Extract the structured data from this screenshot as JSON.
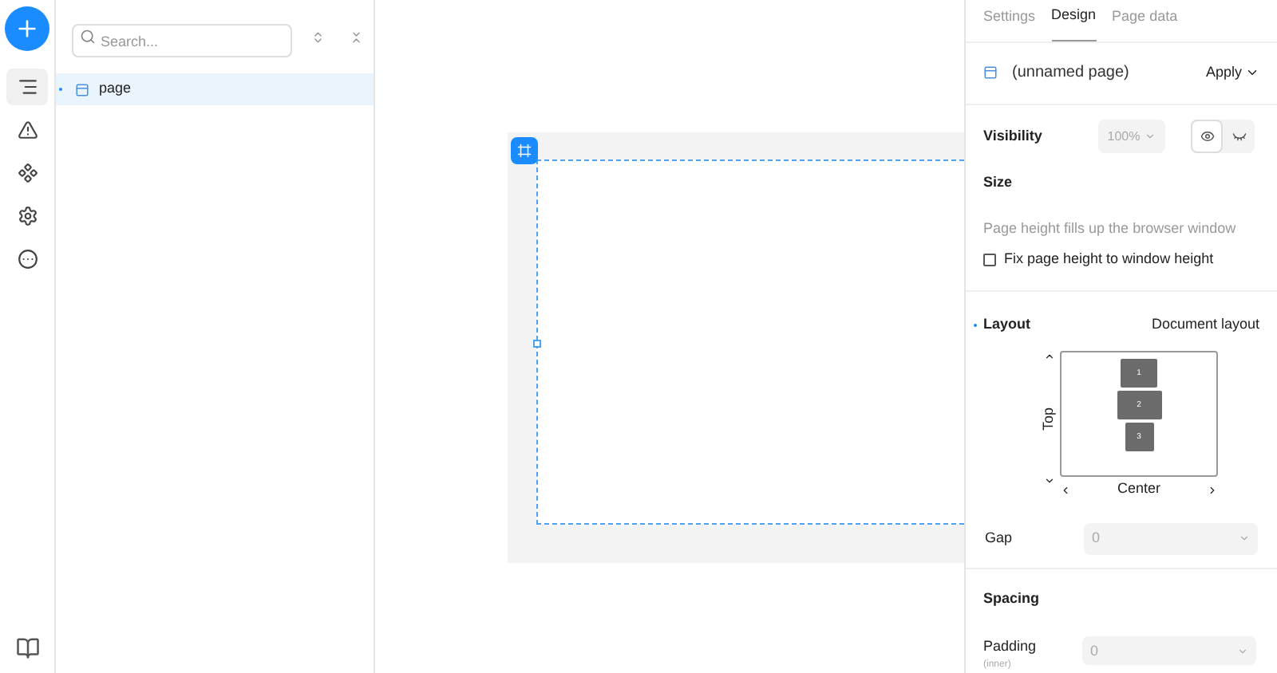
{
  "rail": [
    {
      "kind": "layers",
      "selected": true
    },
    {
      "kind": "warning",
      "selected": false
    },
    {
      "kind": "components",
      "selected": false
    },
    {
      "kind": "settings",
      "selected": false
    },
    {
      "kind": "more",
      "selected": false
    }
  ],
  "search": {
    "placeholder": "Search..."
  },
  "tree": [
    {
      "label": "page",
      "selected": true
    }
  ],
  "tabs": [
    {
      "label": "Settings",
      "selected": false
    },
    {
      "label": "Design",
      "selected": true
    },
    {
      "label": "Page data",
      "selected": false
    }
  ],
  "page_name": "(unnamed page)",
  "apply": "Apply",
  "visibility": {
    "label": "Visibility",
    "opacity": "100%",
    "options": [
      {
        "kind": "visible",
        "selected": true
      },
      {
        "kind": "hidden",
        "selected": false
      }
    ]
  },
  "size": {
    "title": "Size",
    "hint": "Page height fills up the browser window",
    "checkbox": {
      "label": "Fix page height to window height",
      "checked": false
    }
  },
  "layout": {
    "title": "Layout",
    "mode": "Document layout",
    "vertical": "Top",
    "horizontal": "Center",
    "blocks": [
      "1",
      "2",
      "3"
    ]
  },
  "gap": {
    "label": "Gap",
    "value": "0"
  },
  "spacing": {
    "title": "Spacing",
    "label": "Padding",
    "sublabel": "(inner)",
    "value": "0"
  }
}
